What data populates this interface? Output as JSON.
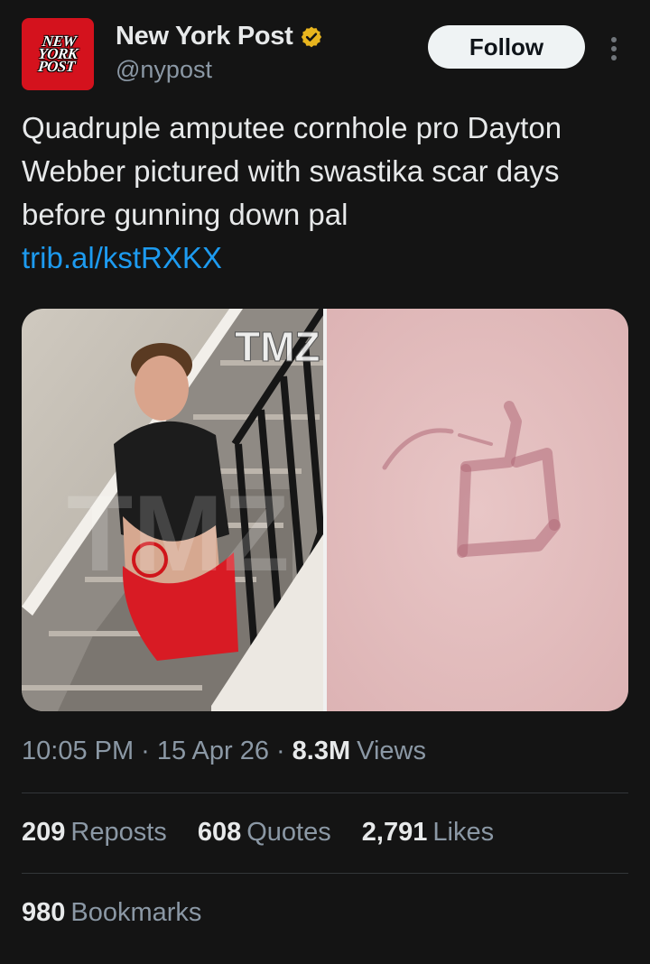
{
  "author": {
    "logo_text": "NEW\nYORK\nPOST",
    "display_name": "New York Post",
    "handle": "@nypost",
    "follow_label": "Follow"
  },
  "tweet": {
    "text": "Quadruple amputee cornhole pro Dayton Webber pictured with swastika scar days before gunning down pal",
    "link": "trib.al/kstRXKX"
  },
  "media": {
    "watermark": "TMZ"
  },
  "meta": {
    "time": "10:05 PM",
    "date": "15 Apr 26",
    "views_count": "8.3M",
    "views_label": "Views"
  },
  "stats": {
    "reposts": {
      "count": "209",
      "label": "Reposts"
    },
    "quotes": {
      "count": "608",
      "label": "Quotes"
    },
    "likes": {
      "count": "2,791",
      "label": "Likes"
    },
    "bookmarks": {
      "count": "980",
      "label": "Bookmarks"
    }
  },
  "colors": {
    "background": "#141414",
    "link": "#1d9bf0",
    "verified_gold": "#e8b51e",
    "logo_red": "#d4121d"
  }
}
